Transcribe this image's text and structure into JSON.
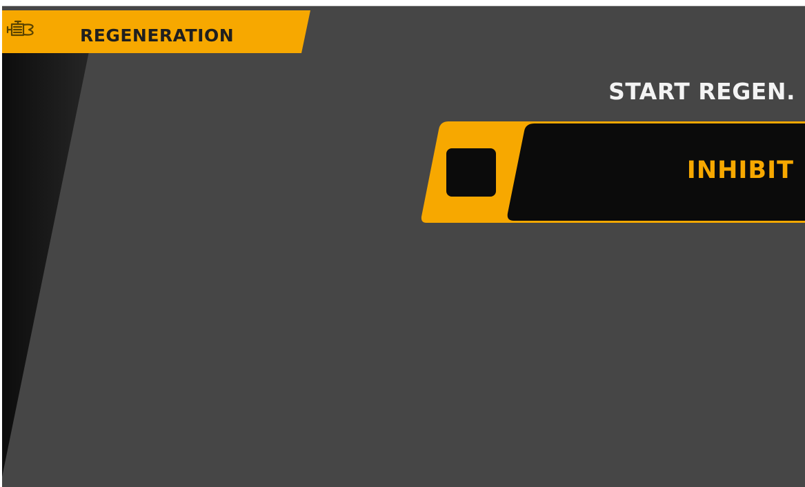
{
  "header": {
    "title": "REGENERATION",
    "icon": "engine-icon"
  },
  "section": {
    "title": "START REGEN."
  },
  "inhibit": {
    "label": "INHIBIT",
    "checked": false
  },
  "colors": {
    "background": "#464646",
    "accent": "#f7a800",
    "dark": "#0b0b0b",
    "text_light": "#f3f3f3"
  }
}
